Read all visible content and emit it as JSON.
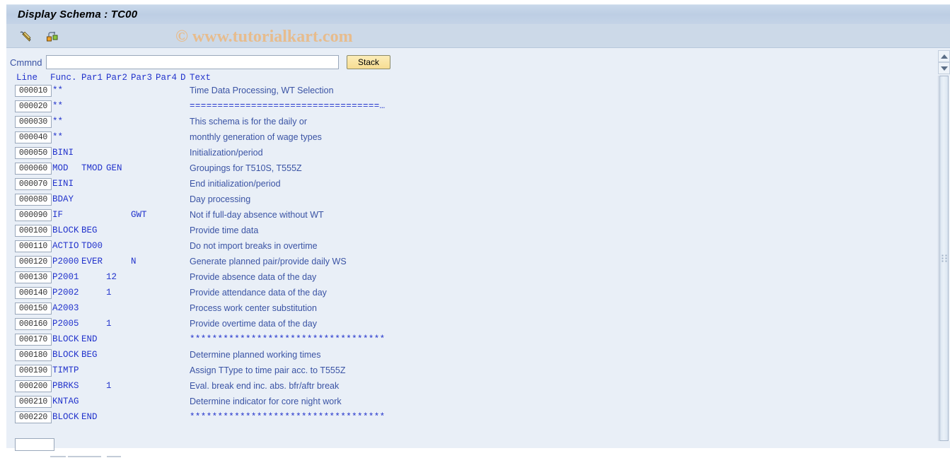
{
  "window": {
    "title": "Display Schema : TC00"
  },
  "toolbar": {
    "icons": [
      {
        "name": "edit-pencil-icon",
        "label": "Change"
      },
      {
        "name": "structure-nodes-icon",
        "label": "Schema structure"
      }
    ]
  },
  "watermark": {
    "text": "© www.tutorialkart.com",
    "color": "#e7bc8d"
  },
  "command": {
    "label": "Cmmnd",
    "value": "",
    "placeholder": "",
    "stack_label": "Stack"
  },
  "table": {
    "headers": {
      "line": "Line",
      "func": "Func.",
      "par1": "Par1",
      "par2": "Par2",
      "par3": "Par3",
      "par4": "Par4",
      "d": "D",
      "text": "Text"
    },
    "rows": [
      {
        "line": "000010",
        "func": "**",
        "par1": "",
        "par2": "",
        "par3": "",
        "par4": "",
        "d": "",
        "text": "Time Data Processing, WT Selection",
        "symbols": false
      },
      {
        "line": "000020",
        "func": "**",
        "par1": "",
        "par2": "",
        "par3": "",
        "par4": "",
        "d": "",
        "text": "==================================…",
        "symbols": true
      },
      {
        "line": "000030",
        "func": "**",
        "par1": "",
        "par2": "",
        "par3": "",
        "par4": "",
        "d": "",
        "text": "This schema is for the daily or",
        "symbols": false
      },
      {
        "line": "000040",
        "func": "**",
        "par1": "",
        "par2": "",
        "par3": "",
        "par4": "",
        "d": "",
        "text": "monthly generation of wage types",
        "symbols": false
      },
      {
        "line": "000050",
        "func": "BINI",
        "par1": "",
        "par2": "",
        "par3": "",
        "par4": "",
        "d": "",
        "text": "Initialization/period",
        "symbols": false
      },
      {
        "line": "000060",
        "func": "MOD",
        "par1": "TMOD",
        "par2": "GEN",
        "par3": "",
        "par4": "",
        "d": "",
        "text": "Groupings for T510S, T555Z",
        "symbols": false
      },
      {
        "line": "000070",
        "func": "EINI",
        "par1": "",
        "par2": "",
        "par3": "",
        "par4": "",
        "d": "",
        "text": "End initialization/period",
        "symbols": false
      },
      {
        "line": "000080",
        "func": "BDAY",
        "par1": "",
        "par2": "",
        "par3": "",
        "par4": "",
        "d": "",
        "text": "Day processing",
        "symbols": false
      },
      {
        "line": "000090",
        "func": "IF",
        "par1": "",
        "par2": "",
        "par3": "GWT",
        "par4": "",
        "d": "",
        "text": "Not if full-day absence without WT",
        "symbols": false
      },
      {
        "line": "000100",
        "func": "BLOCK",
        "par1": "BEG",
        "par2": "",
        "par3": "",
        "par4": "",
        "d": "",
        "text": "Provide time data",
        "symbols": false
      },
      {
        "line": "000110",
        "func": "ACTIO",
        "par1": "TD00",
        "par2": "",
        "par3": "",
        "par4": "",
        "d": "",
        "text": "Do not import breaks in overtime",
        "symbols": false
      },
      {
        "line": "000120",
        "func": "P2000",
        "par1": "EVER",
        "par2": "",
        "par3": "N",
        "par4": "",
        "d": "",
        "text": "Generate planned pair/provide daily WS",
        "symbols": false
      },
      {
        "line": "000130",
        "func": "P2001",
        "par1": "",
        "par2": "12",
        "par3": "",
        "par4": "",
        "d": "",
        "text": "Provide absence data of the day",
        "symbols": false
      },
      {
        "line": "000140",
        "func": "P2002",
        "par1": "",
        "par2": "1",
        "par3": "",
        "par4": "",
        "d": "",
        "text": "Provide attendance data of the day",
        "symbols": false
      },
      {
        "line": "000150",
        "func": "A2003",
        "par1": "",
        "par2": "",
        "par3": "",
        "par4": "",
        "d": "",
        "text": "Process work center substitution",
        "symbols": false
      },
      {
        "line": "000160",
        "func": "P2005",
        "par1": "",
        "par2": "1",
        "par3": "",
        "par4": "",
        "d": "",
        "text": "Provide overtime data of the day",
        "symbols": false
      },
      {
        "line": "000170",
        "func": "BLOCK",
        "par1": "END",
        "par2": "",
        "par3": "",
        "par4": "",
        "d": "",
        "text": "***********************************",
        "symbols": true
      },
      {
        "line": "000180",
        "func": "BLOCK",
        "par1": "BEG",
        "par2": "",
        "par3": "",
        "par4": "",
        "d": "",
        "text": "Determine planned working times",
        "symbols": false
      },
      {
        "line": "000190",
        "func": "TIMTP",
        "par1": "",
        "par2": "",
        "par3": "",
        "par4": "",
        "d": "",
        "text": "Assign TType to time pair acc. to T555Z",
        "symbols": false
      },
      {
        "line": "000200",
        "func": "PBRKS",
        "par1": "",
        "par2": "1",
        "par3": "",
        "par4": "",
        "d": "",
        "text": "Eval. break end inc. abs. bfr/aftr break",
        "symbols": false
      },
      {
        "line": "000210",
        "func": "KNTAG",
        "par1": "",
        "par2": "",
        "par3": "",
        "par4": "",
        "d": "",
        "text": "Determine indicator for core night work",
        "symbols": false
      },
      {
        "line": "000220",
        "func": "BLOCK",
        "par1": "END",
        "par2": "",
        "par3": "",
        "par4": "",
        "d": "",
        "text": "***********************************",
        "symbols": true
      }
    ]
  },
  "scrollbar": {
    "up_icon": "arrow-up-icon",
    "down_icon": "arrow-down-icon"
  },
  "colors": {
    "accent_blue": "#3a53a4",
    "mono_blue": "#2233cc",
    "panel_bg": "#e9eff7",
    "titlebar_bg": "#c4d3e7",
    "button_yellow": "#f7dd92"
  }
}
